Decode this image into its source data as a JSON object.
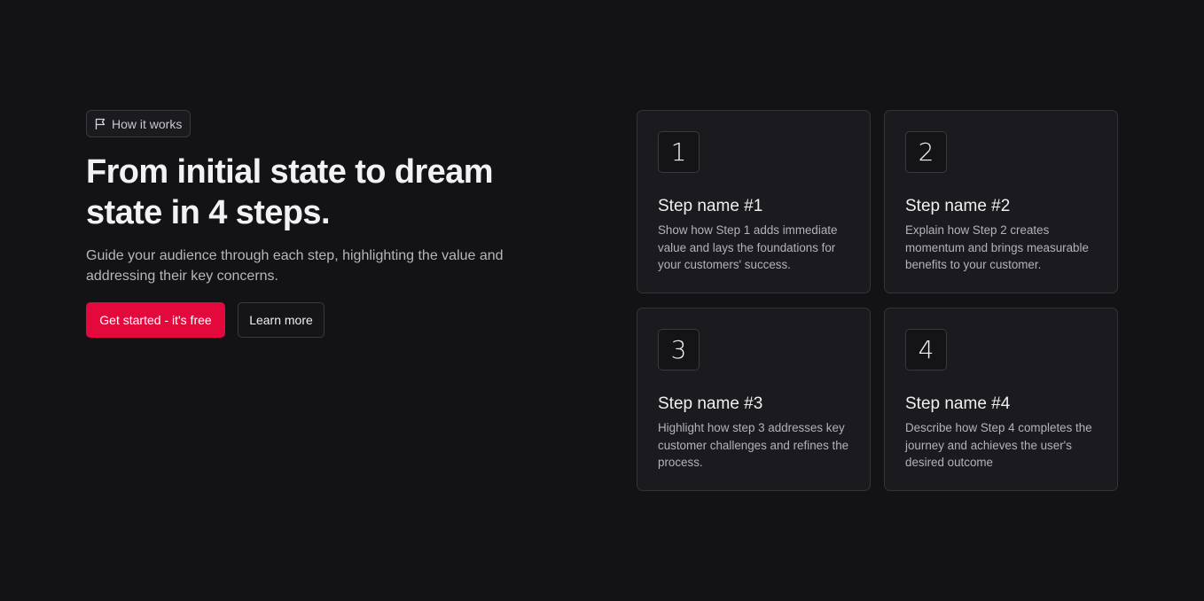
{
  "badge": {
    "label": "How it works",
    "icon": "flag-icon"
  },
  "hero": {
    "title": "From initial state to dream state in 4 steps.",
    "subtitle": "Guide your audience through each step, highlighting the value and addressing their key concerns."
  },
  "buttons": {
    "primary_label": "Get started - it's free",
    "secondary_label": "Learn more"
  },
  "steps": [
    {
      "number": "1",
      "title": "Step name #1",
      "description": "Show how Step 1 adds immediate value and lays the foundations for your customers' success."
    },
    {
      "number": "2",
      "title": "Step name #2",
      "description": "Explain how Step 2 creates momentum and brings measurable benefits to your customer."
    },
    {
      "number": "3",
      "title": "Step name #3",
      "description": "Highlight how step 3 addresses key customer challenges and refines the process."
    },
    {
      "number": "4",
      "title": "Step name #4",
      "description": "Describe how Step 4 completes the journey and achieves the user's desired outcome"
    }
  ],
  "colors": {
    "background": "#131215",
    "accent": "#e3093d",
    "card_background": "#1b1a1e",
    "border": "#34333a"
  }
}
